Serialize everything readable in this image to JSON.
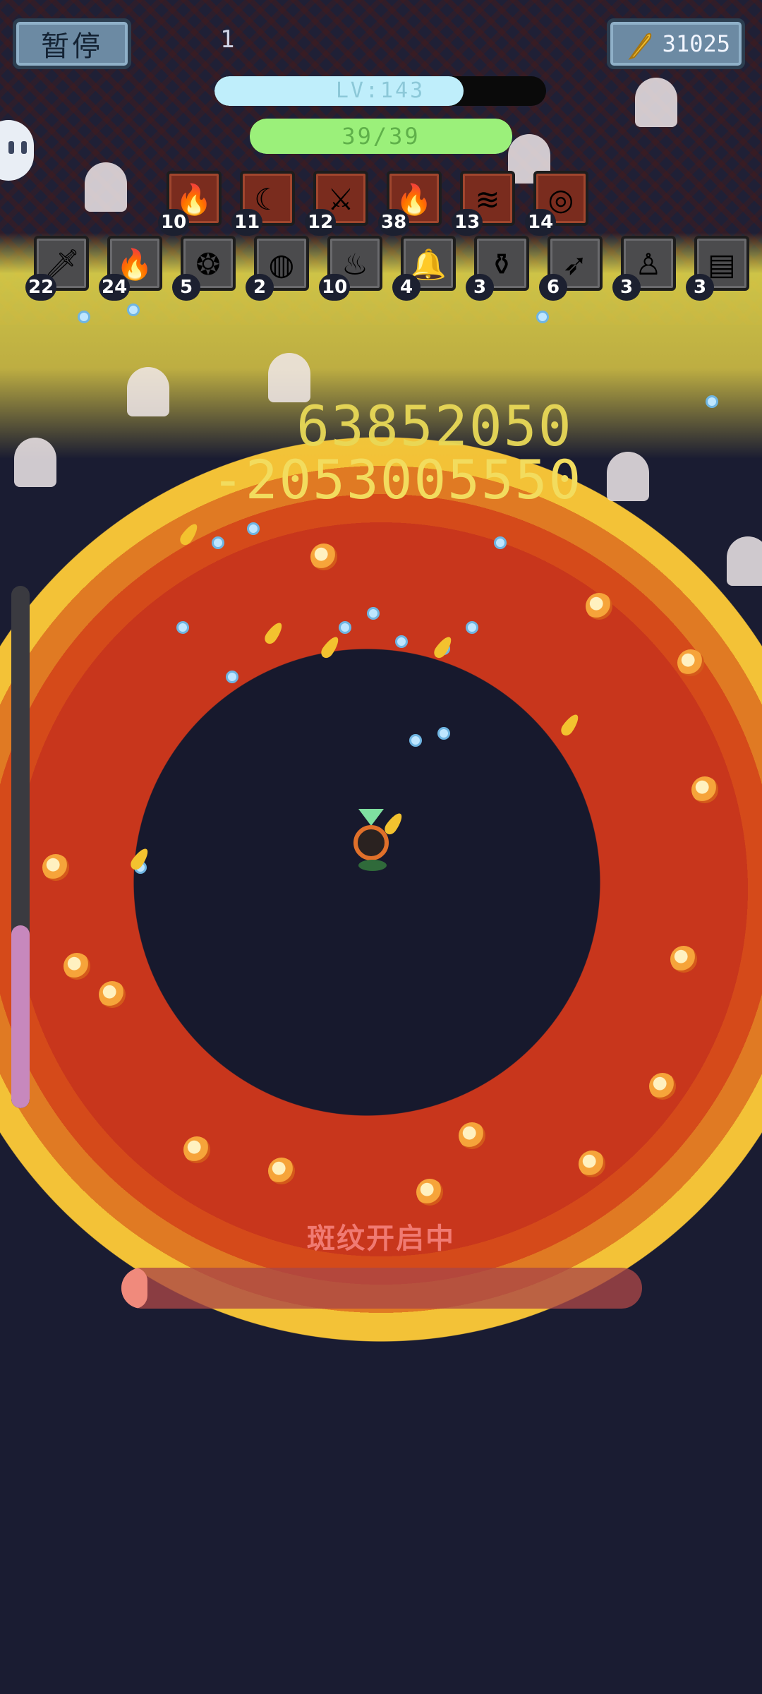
{
  "hud": {
    "pause_label": "暂停",
    "coins": "31025",
    "wave_count": "1",
    "level_text": "LV:143",
    "level_progress": 0.75,
    "hp_text": "39/39",
    "hp_fraction": 1.0,
    "xp_fraction": 0.35
  },
  "weapons": [
    {
      "icon": "fire-icon",
      "glyph": "🔥",
      "count": "10"
    },
    {
      "icon": "crescent-slash-icon",
      "glyph": "☾",
      "count": "11"
    },
    {
      "icon": "blade-icon",
      "glyph": "⚔",
      "count": "12"
    },
    {
      "icon": "flame-icon",
      "glyph": "🔥",
      "count": "38"
    },
    {
      "icon": "claw-slash-icon",
      "glyph": "≋",
      "count": "13"
    },
    {
      "icon": "fire-ring-icon",
      "glyph": "◎",
      "count": "14"
    }
  ],
  "passives": [
    {
      "icon": "dagger-icon",
      "glyph": "🗡",
      "count": "22"
    },
    {
      "icon": "flame-icon",
      "glyph": "🔥",
      "count": "24"
    },
    {
      "icon": "amulet-icon",
      "glyph": "❂",
      "count": "5"
    },
    {
      "icon": "shield-icon",
      "glyph": "◍",
      "count": "2"
    },
    {
      "icon": "meat-icon",
      "glyph": "♨",
      "count": "10"
    },
    {
      "icon": "bell-icon",
      "glyph": "🔔",
      "count": "4"
    },
    {
      "icon": "potion-icon",
      "glyph": "⚱",
      "count": "3"
    },
    {
      "icon": "feather-icon",
      "glyph": "➶",
      "count": "6"
    },
    {
      "icon": "robe-icon",
      "glyph": "♙",
      "count": "3"
    },
    {
      "icon": "scroll-icon",
      "glyph": "▤",
      "count": "3"
    }
  ],
  "damage_numbers": [
    "63852050",
    "-2053005550"
  ],
  "banner": {
    "text": "斑纹开启中",
    "progress": 0.03
  },
  "colors": {
    "weapon_slot": "#7a2c1e",
    "passive_slot": "#4b4b4d",
    "hp_fill": "#9bf07a",
    "level_fill": "#bfeefb",
    "xp_fill": "#c788bd",
    "damage_text": "#f2dc5e"
  }
}
